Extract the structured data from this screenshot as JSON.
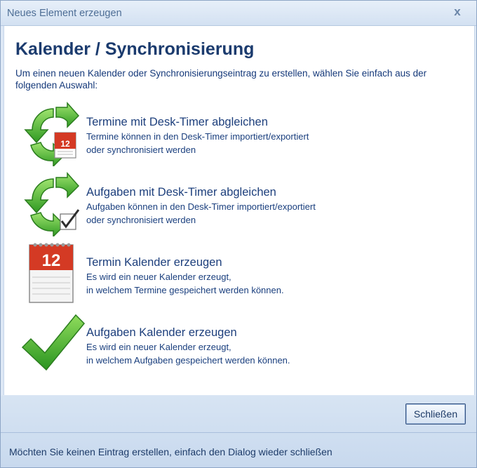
{
  "window": {
    "title": "Neues Element erzeugen",
    "close_glyph": "x"
  },
  "main": {
    "heading": "Kalender / Synchronisierung",
    "intro": "Um einen neuen Kalender oder Synchronisierungseintrag zu erstellen, wählen Sie einfach aus der folgenden Auswahl:"
  },
  "options": [
    {
      "icon": "sync-calendar-icon",
      "title": "Termine mit Desk-Timer abgleichen",
      "desc1": "Termine können in den Desk-Timer importiert/exportiert",
      "desc2": "oder synchronisiert werden"
    },
    {
      "icon": "sync-check-icon",
      "title": "Aufgaben mit Desk-Timer abgleichen",
      "desc1": "Aufgaben können in den Desk-Timer importiert/exportiert",
      "desc2": "oder synchronisiert werden"
    },
    {
      "icon": "calendar-icon",
      "title": "Termin Kalender erzeugen",
      "desc1": "Es wird ein neuer Kalender erzeugt,",
      "desc2": "in welchem Termine gespeichert werden können."
    },
    {
      "icon": "checkmark-icon",
      "title": "Aufgaben Kalender erzeugen",
      "desc1": "Es wird ein neuer Kalender erzeugt,",
      "desc2": "in welchem Aufgaben gespeichert werden können."
    }
  ],
  "calendar_day": "12",
  "footer": {
    "close_label": "Schließen",
    "status": "Möchten Sie keinen Eintrag erstellen, einfach den Dialog wieder schließen"
  },
  "colors": {
    "accent_green": "#3cb52c",
    "calendar_red": "#d43a24",
    "heading_blue": "#1b3b6e"
  }
}
